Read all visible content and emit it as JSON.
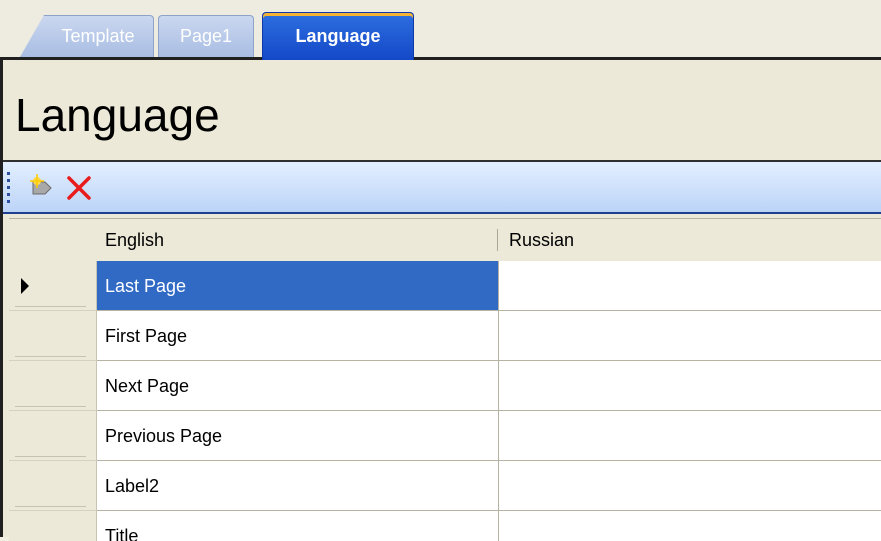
{
  "tabs": [
    {
      "label": "Template"
    },
    {
      "label": "Page1"
    },
    {
      "label": "Language"
    }
  ],
  "title": "Language",
  "toolbar": {
    "icons": [
      "new-row-icon",
      "delete-icon"
    ],
    "delete_color": "#e81c1c"
  },
  "grid": {
    "columns": [
      "English",
      "Russian"
    ],
    "rows": [
      {
        "english": "Last Page",
        "russian": ""
      },
      {
        "english": "First Page",
        "russian": ""
      },
      {
        "english": "Next Page",
        "russian": ""
      },
      {
        "english": "Previous Page",
        "russian": ""
      },
      {
        "english": "Label2",
        "russian": ""
      },
      {
        "english": "Title",
        "russian": ""
      }
    ],
    "selected_row": 0
  },
  "colors": {
    "active_tab": "#1d56d4",
    "selection": "#316ac5"
  }
}
